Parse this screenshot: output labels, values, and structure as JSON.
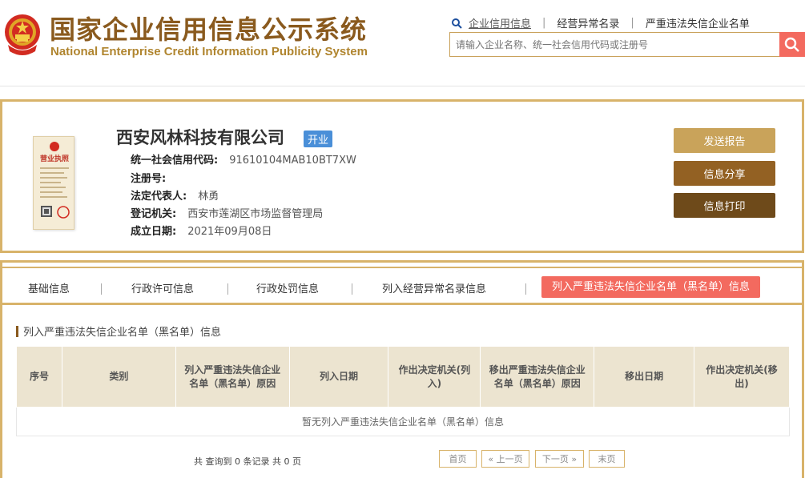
{
  "header": {
    "title_cn": "国家企业信用信息公示系统",
    "title_en": "National Enterprise Credit Information Publicity System",
    "nav": [
      {
        "label": "企业信用信息",
        "active": true
      },
      {
        "label": "经营异常名录",
        "active": false
      },
      {
        "label": "严重违法失信企业名单",
        "active": false
      }
    ],
    "search_placeholder": "请输入企业名称、统一社会信用代码或注册号"
  },
  "company": {
    "name": "西安风林科技有限公司",
    "status": "开业",
    "license_text": "营业执照",
    "fields": [
      {
        "label": "统一社会信用代码:",
        "value": "91610104MAB10BT7XW"
      },
      {
        "label": "注册号:",
        "value": ""
      },
      {
        "label": "法定代表人:",
        "value": "林勇"
      },
      {
        "label": "登记机关:",
        "value": "西安市莲湖区市场监督管理局"
      },
      {
        "label": "成立日期:",
        "value": "2021年09月08日"
      }
    ],
    "actions": {
      "report": "发送报告",
      "share": "信息分享",
      "print": "信息打印"
    }
  },
  "tabs": [
    {
      "label": "基础信息",
      "active": false
    },
    {
      "label": "行政许可信息",
      "active": false
    },
    {
      "label": "行政处罚信息",
      "active": false
    },
    {
      "label": "列入经营异常名录信息",
      "active": false
    },
    {
      "label": "列入严重违法失信企业名单（黑名单）信息",
      "active": true
    }
  ],
  "blacklist": {
    "title": "列入严重违法失信企业名单（黑名单）信息",
    "columns": [
      "序号",
      "类别",
      "列入严重违法失信企业名单（黑名单）原因",
      "列入日期",
      "作出决定机关(列入)",
      "移出严重违法失信企业名单（黑名单）原因",
      "移出日期",
      "作出决定机关(移出)"
    ],
    "empty_text": "暂无列入严重违法失信企业名单（黑名单）信息"
  },
  "pager": {
    "summary": "共 查询到 0 条记录 共 0 页",
    "first": "首页",
    "prev": "« 上一页",
    "next": "下一页 »",
    "last": "末页"
  },
  "colors": {
    "accent": "#f36a5f",
    "gold": "#d8b36a",
    "brown": "#8a5a1e",
    "badge": "#4a8fd8"
  }
}
